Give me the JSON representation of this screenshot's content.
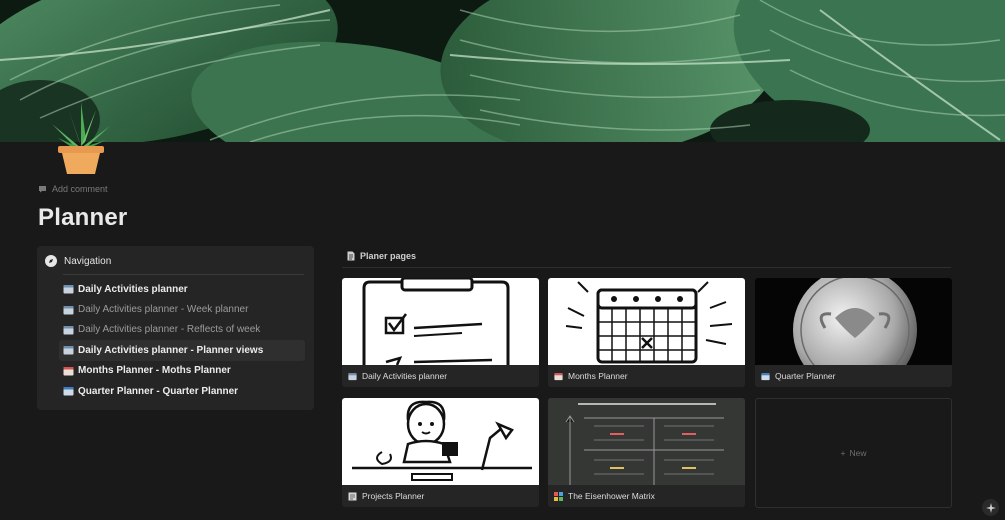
{
  "cover": {
    "image": "green-leaves-cover"
  },
  "page_icon": "potted-plant-icon",
  "add_comment": "Add comment",
  "title": "Planner",
  "navigation": {
    "heading": "Navigation",
    "items": [
      {
        "label": "Daily Activities planner",
        "icon": "calendar-icon"
      },
      {
        "label": "Daily Activities planner - Week planner",
        "icon": "calendar-icon"
      },
      {
        "label": "Daily Activities planner - Reflects of week",
        "icon": "calendar-icon"
      },
      {
        "label": "Daily Activities planner - Planner views",
        "icon": "calendar-icon"
      },
      {
        "label": "Months Planner - Moths Planner",
        "icon": "calendar-red-icon"
      },
      {
        "label": "Quarter Planner - Quarter Planner",
        "icon": "calendar-blue-icon"
      }
    ]
  },
  "gallery": {
    "heading": "Planer pages",
    "cards": [
      {
        "title": "Daily Activities planner",
        "image": "checklist-sketch",
        "icon": "calendar-icon"
      },
      {
        "title": "Months Planner",
        "image": "calendar-sketch",
        "icon": "calendar-red-icon"
      },
      {
        "title": "Quarter Planner",
        "image": "quarter-coin",
        "icon": "calendar-blue-icon"
      },
      {
        "title": "Projects Planner",
        "image": "desk-person-sketch",
        "icon": "document-icon"
      },
      {
        "title": "The Eisenhower Matrix",
        "image": "eisenhower-matrix-chalkboard",
        "icon": "grid-four-colors-icon"
      }
    ],
    "new_label": "New"
  },
  "colors": {
    "background": "#191919",
    "panel": "#252525",
    "accent_leaf": "#2f6b45"
  }
}
